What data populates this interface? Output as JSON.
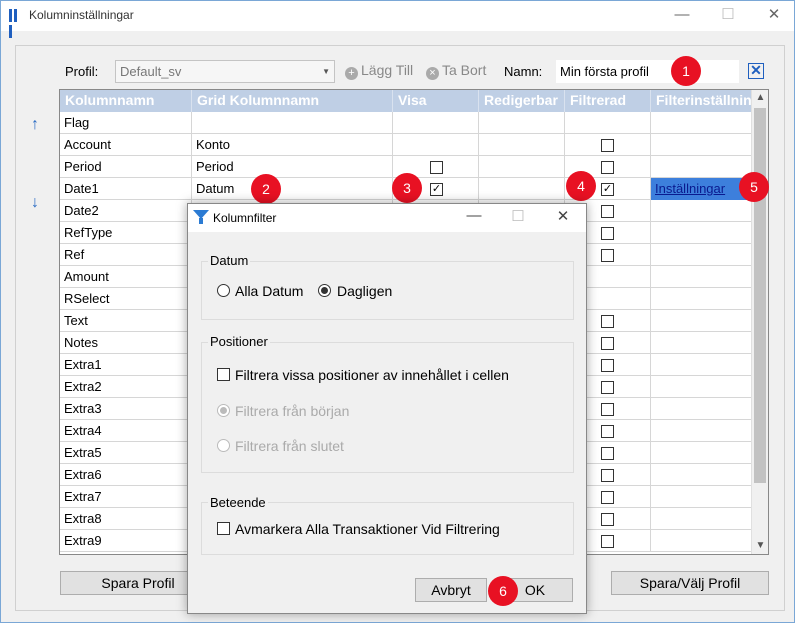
{
  "window": {
    "title": "Kolumninställningar",
    "minimize": "—",
    "maximize": "☐",
    "close": "✕"
  },
  "toolbar": {
    "profile_label": "Profil:",
    "profile_value": "Default_sv",
    "add_label": "Lägg Till",
    "remove_label": "Ta Bort",
    "name_label": "Namn:",
    "name_value": "Min första profil"
  },
  "markers": [
    "1",
    "2",
    "3",
    "4",
    "5",
    "6"
  ],
  "grid": {
    "headers": [
      "Kolumnnamn",
      "Grid Kolumnnamn",
      "Visa",
      "Redigerbar",
      "Filtrerad",
      "Filterinställningar"
    ],
    "rows": [
      {
        "name": "Flag",
        "grid_name": "",
        "visa": null,
        "filtrerad": null
      },
      {
        "name": "Account",
        "grid_name": "Konto",
        "visa": null,
        "filtrerad": false
      },
      {
        "name": "Period",
        "grid_name": "Period",
        "visa": false,
        "filtrerad": false
      },
      {
        "name": "Date1",
        "grid_name": "Datum",
        "visa": true,
        "filtrerad": true,
        "settings": "Inställningar"
      },
      {
        "name": "Date2",
        "grid_name": "",
        "visa": null,
        "filtrerad": false
      },
      {
        "name": "RefType",
        "grid_name": "",
        "visa": null,
        "filtrerad": false
      },
      {
        "name": "Ref",
        "grid_name": "",
        "visa": null,
        "filtrerad": false
      },
      {
        "name": "Amount",
        "grid_name": "",
        "visa": null,
        "filtrerad": null
      },
      {
        "name": "RSelect",
        "grid_name": "",
        "visa": null,
        "filtrerad": null
      },
      {
        "name": "Text",
        "grid_name": "",
        "visa": null,
        "filtrerad": false
      },
      {
        "name": "Notes",
        "grid_name": "",
        "visa": null,
        "filtrerad": false
      },
      {
        "name": "Extra1",
        "grid_name": "",
        "visa": null,
        "filtrerad": false
      },
      {
        "name": "Extra2",
        "grid_name": "",
        "visa": null,
        "filtrerad": false
      },
      {
        "name": "Extra3",
        "grid_name": "",
        "visa": null,
        "filtrerad": false
      },
      {
        "name": "Extra4",
        "grid_name": "",
        "visa": null,
        "filtrerad": false
      },
      {
        "name": "Extra5",
        "grid_name": "",
        "visa": null,
        "filtrerad": false
      },
      {
        "name": "Extra6",
        "grid_name": "",
        "visa": null,
        "filtrerad": false
      },
      {
        "name": "Extra7",
        "grid_name": "",
        "visa": null,
        "filtrerad": false
      },
      {
        "name": "Extra8",
        "grid_name": "",
        "visa": null,
        "filtrerad": false
      },
      {
        "name": "Extra9",
        "grid_name": "",
        "visa": null,
        "filtrerad": false
      }
    ]
  },
  "buttons": {
    "save_profile": "Spara Profil",
    "save_select_profile": "Spara/Välj Profil"
  },
  "dialog": {
    "title": "Kolumnfilter",
    "date_group": "Datum",
    "all_dates": "Alla Datum",
    "daily": "Dagligen",
    "positions_group": "Positioner",
    "filter_positions": "Filtrera vissa positioner av innehållet i cellen",
    "from_start": "Filtrera från början",
    "from_end": "Filtrera från slutet",
    "behavior_group": "Beteende",
    "unmark_all": "Avmarkera Alla Transaktioner Vid Filtrering",
    "cancel": "Avbryt",
    "ok": "OK"
  },
  "colors": {
    "header_bg": "#bfcfe5",
    "marker": "#e81123",
    "accent": "#1f5fbf"
  }
}
